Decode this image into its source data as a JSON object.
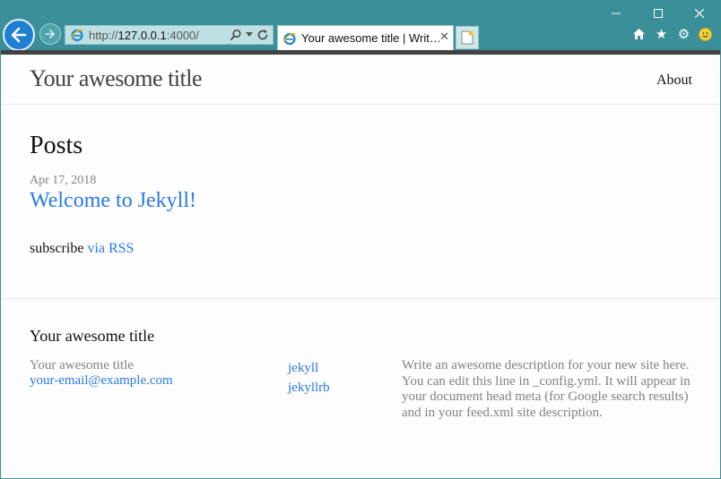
{
  "browser": {
    "url_prefix": "http://",
    "url_host": "127.0.0.1",
    "url_rest": ":4000/",
    "tab_title": "Your awesome title | Writ…",
    "icons": {
      "back": "arrow-left-icon",
      "forward": "arrow-right-icon",
      "search": "search-icon",
      "refresh": "refresh-icon",
      "close_tab": "close-icon",
      "new_tab": "new-tab-icon",
      "home": "home-icon",
      "favorites": "star-icon",
      "tools": "gear-icon",
      "feedback": "smiley-icon"
    },
    "colors": {
      "chrome": "#3a8f99",
      "back_button": "#1f7fd1"
    }
  },
  "site": {
    "title": "Your awesome title",
    "nav": {
      "about": "About"
    },
    "colors": {
      "link": "#2a7ae2",
      "muted": "#828282",
      "text": "#111111"
    }
  },
  "main": {
    "heading": "Posts",
    "posts": [
      {
        "date": "Apr 17, 2018",
        "title": "Welcome to Jekyll!"
      }
    ],
    "subscribe_text": "subscribe",
    "subscribe_link": "via RSS"
  },
  "footer": {
    "heading": "Your awesome title",
    "name": "Your awesome title",
    "email": "your-email@example.com",
    "social": [
      "jekyll",
      "jekyllrb"
    ],
    "description": "Write an awesome description for your new site here. You can edit this line in _config.yml. It will appear in your document head meta (for Google search results) and in your feed.xml site description."
  }
}
